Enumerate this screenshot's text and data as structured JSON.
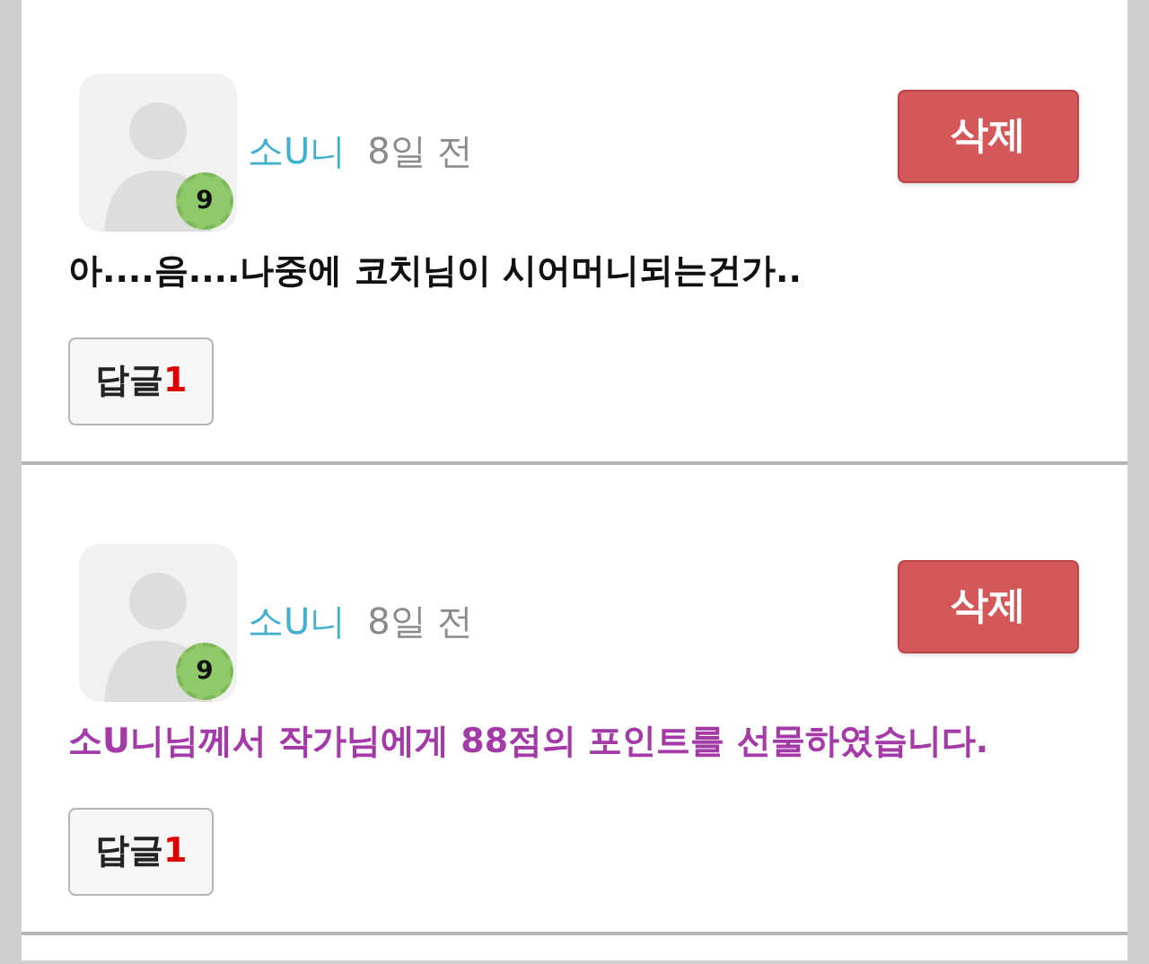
{
  "comments": [
    {
      "author": "소U니",
      "time": "8일 전",
      "level_badge": "9",
      "delete_label": "삭제",
      "kind": "text",
      "message": "아....음....나중에 코치님이 시어머니되는건가..",
      "reply_label": "답글",
      "reply_count": "1"
    },
    {
      "author": "소U니",
      "time": "8일 전",
      "level_badge": "9",
      "delete_label": "삭제",
      "kind": "gift",
      "message": "소U니님께서 작가님에게 88점의 포인트를 선물하였습니다.",
      "reply_label": "답글",
      "reply_count": "1"
    }
  ]
}
